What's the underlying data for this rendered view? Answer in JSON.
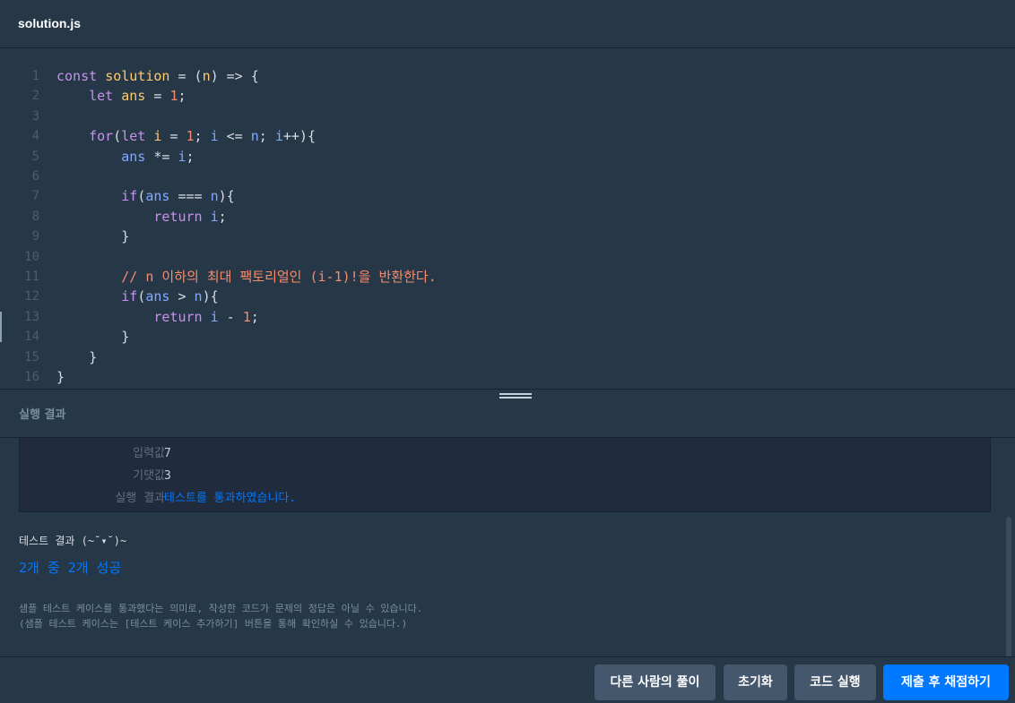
{
  "tab": {
    "title": "solution.js"
  },
  "editor": {
    "lines": [
      {
        "n": "1",
        "tokens": [
          {
            "t": "const ",
            "c": "kw"
          },
          {
            "t": "solution",
            "c": "fn"
          },
          {
            "t": " = (",
            "c": ""
          },
          {
            "t": "n",
            "c": "fn"
          },
          {
            "t": ") => {",
            "c": ""
          }
        ]
      },
      {
        "n": "2",
        "tokens": [
          {
            "t": "    ",
            "c": ""
          },
          {
            "t": "let ",
            "c": "kw"
          },
          {
            "t": "ans",
            "c": "fn"
          },
          {
            "t": " = ",
            "c": ""
          },
          {
            "t": "1",
            "c": "num"
          },
          {
            "t": ";",
            "c": ""
          }
        ]
      },
      {
        "n": "3",
        "tokens": []
      },
      {
        "n": "4",
        "tokens": [
          {
            "t": "    ",
            "c": ""
          },
          {
            "t": "for",
            "c": "kw"
          },
          {
            "t": "(",
            "c": ""
          },
          {
            "t": "let ",
            "c": "kw"
          },
          {
            "t": "i",
            "c": "fn"
          },
          {
            "t": " = ",
            "c": ""
          },
          {
            "t": "1",
            "c": "num"
          },
          {
            "t": "; ",
            "c": ""
          },
          {
            "t": "i",
            "c": "var"
          },
          {
            "t": " <= ",
            "c": ""
          },
          {
            "t": "n",
            "c": "var"
          },
          {
            "t": "; ",
            "c": ""
          },
          {
            "t": "i",
            "c": "var"
          },
          {
            "t": "++){",
            "c": ""
          }
        ]
      },
      {
        "n": "5",
        "tokens": [
          {
            "t": "        ",
            "c": ""
          },
          {
            "t": "ans",
            "c": "var"
          },
          {
            "t": " *= ",
            "c": ""
          },
          {
            "t": "i",
            "c": "var"
          },
          {
            "t": ";",
            "c": ""
          }
        ]
      },
      {
        "n": "6",
        "tokens": []
      },
      {
        "n": "7",
        "tokens": [
          {
            "t": "        ",
            "c": ""
          },
          {
            "t": "if",
            "c": "kw"
          },
          {
            "t": "(",
            "c": ""
          },
          {
            "t": "ans",
            "c": "var"
          },
          {
            "t": " === ",
            "c": ""
          },
          {
            "t": "n",
            "c": "var"
          },
          {
            "t": "){",
            "c": ""
          }
        ]
      },
      {
        "n": "8",
        "tokens": [
          {
            "t": "            ",
            "c": ""
          },
          {
            "t": "return ",
            "c": "kw"
          },
          {
            "t": "i",
            "c": "var"
          },
          {
            "t": ";",
            "c": ""
          }
        ]
      },
      {
        "n": "9",
        "tokens": [
          {
            "t": "        }",
            "c": ""
          }
        ]
      },
      {
        "n": "10",
        "tokens": []
      },
      {
        "n": "11",
        "tokens": [
          {
            "t": "        ",
            "c": ""
          },
          {
            "t": "// n 이하의 최대 팩토리얼인 (i-1)!을 반환한다.",
            "c": "cm"
          }
        ]
      },
      {
        "n": "12",
        "tokens": [
          {
            "t": "        ",
            "c": ""
          },
          {
            "t": "if",
            "c": "kw"
          },
          {
            "t": "(",
            "c": ""
          },
          {
            "t": "ans",
            "c": "var"
          },
          {
            "t": " > ",
            "c": ""
          },
          {
            "t": "n",
            "c": "var"
          },
          {
            "t": "){",
            "c": ""
          }
        ]
      },
      {
        "n": "13",
        "tokens": [
          {
            "t": "            ",
            "c": ""
          },
          {
            "t": "return ",
            "c": "kw"
          },
          {
            "t": "i",
            "c": "var"
          },
          {
            "t": " - ",
            "c": ""
          },
          {
            "t": "1",
            "c": "num"
          },
          {
            "t": ";",
            "c": ""
          }
        ]
      },
      {
        "n": "14",
        "tokens": [
          {
            "t": "        }",
            "c": ""
          }
        ]
      },
      {
        "n": "15",
        "tokens": [
          {
            "t": "    }",
            "c": ""
          }
        ]
      },
      {
        "n": "16",
        "tokens": [
          {
            "t": "}",
            "c": ""
          }
        ]
      }
    ]
  },
  "results": {
    "label": "실행 결과",
    "case": {
      "input_key": "입력값",
      "input_val": "7",
      "expected_key": "기댓값",
      "expected_val": "3",
      "result_key": "실행 결과",
      "result_val": "테스트를 통과하였습니다.",
      "separator": "〉"
    },
    "summary_title": "테스트 결과 (~˘▾˘)~",
    "summary_count": "2개 중 2개 성공",
    "notice_line1": "샘플 테스트 케이스를 통과했다는 의미로, 작성한 코드가 문제의 정답은 아닐 수 있습니다.",
    "notice_line2": "(샘플 테스트 케이스는 [테스트 케이스 추가하기] 버튼을 통해 확인하실 수 있습니다.)"
  },
  "footer": {
    "others_label": "다른 사람의 풀이",
    "reset_label": "초기화",
    "run_label": "코드 실행",
    "submit_label": "제출 후 채점하기"
  },
  "colors": {
    "accent": "#0078ff",
    "background": "#263747",
    "button": "#44576c"
  }
}
